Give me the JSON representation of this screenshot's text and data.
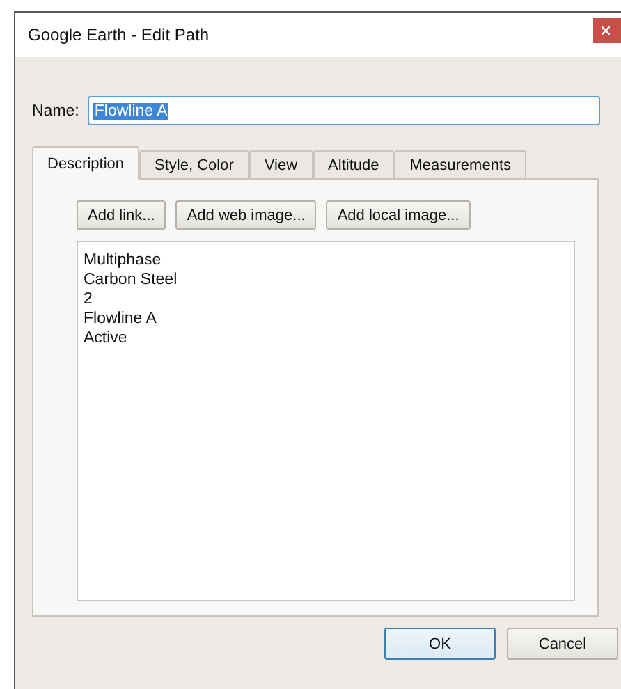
{
  "window": {
    "title": "Google Earth - Edit Path"
  },
  "name_field": {
    "label": "Name:",
    "value": "Flowline A",
    "highlighted": true
  },
  "tabs": [
    {
      "label": "Description",
      "selected": true
    },
    {
      "label": "Style, Color",
      "selected": false
    },
    {
      "label": "View",
      "selected": false
    },
    {
      "label": "Altitude",
      "selected": false
    },
    {
      "label": "Measurements",
      "selected": false
    }
  ],
  "toolbar": [
    "Add link...",
    "Add web image...",
    "Add local image..."
  ],
  "description_lines": [
    "Multiphase",
    "Carbon Steel",
    "2",
    "Flowline A",
    "Active"
  ],
  "buttons": [
    {
      "label": "OK",
      "default": true
    },
    {
      "label": "Cancel",
      "default": false
    }
  ]
}
